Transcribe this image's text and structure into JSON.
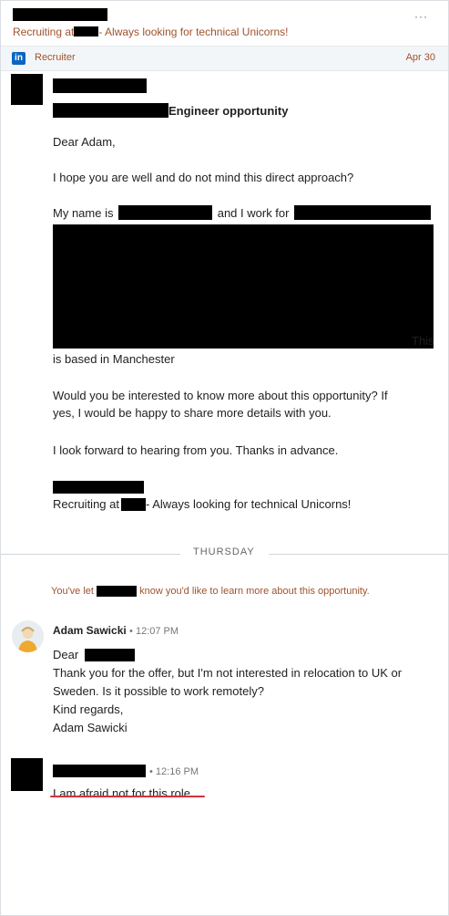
{
  "header": {
    "subtitle_prefix": "Recruiting at",
    "subtitle_suffix": "- Always looking for technical Unicorns!",
    "more_label": "···"
  },
  "source_bar": {
    "icon": "linkedin-icon",
    "icon_text": "in",
    "label": "Recruiter",
    "date": "Apr 30"
  },
  "message1": {
    "subject_suffix": "Engineer opportunity",
    "greeting": "Dear Adam,",
    "para1": "I hope you are well and do not mind this direct approach?",
    "my_name_is": "My name is",
    "and_i_work_for": "and I work for",
    "this_word": "This",
    "based_line": "is based in Manchester",
    "para3_line1": "Would you be interested to know more about this opportunity? If",
    "para3_line2": "yes, I would be happy to share more details with you.",
    "para4": "I look forward to hearing from you. Thanks in advance.",
    "sig_prefix": "Recruiting at",
    "sig_suffix": "- Always looking for technical Unicorns!"
  },
  "divider": {
    "label": "THURSDAY"
  },
  "system_note": {
    "prefix": "You've let",
    "suffix": "know you'd like to learn more about this opportunity."
  },
  "message2": {
    "sender": "Adam Sawicki",
    "time": "• 12:07 PM",
    "greeting": "Dear",
    "line1": "Thank you for the offer, but I'm not interested in relocation to UK or",
    "line2": "Sweden. Is it possible to work remotely?",
    "line3": "Kind regards,",
    "line4": "Adam Sawicki"
  },
  "message3": {
    "time": "• 12:16 PM",
    "text": "I am afraid not for this role"
  },
  "colors": {
    "accent_brown": "#a0522d",
    "linkedin_blue": "#0a66c2",
    "underline_red": "#d1323c"
  }
}
